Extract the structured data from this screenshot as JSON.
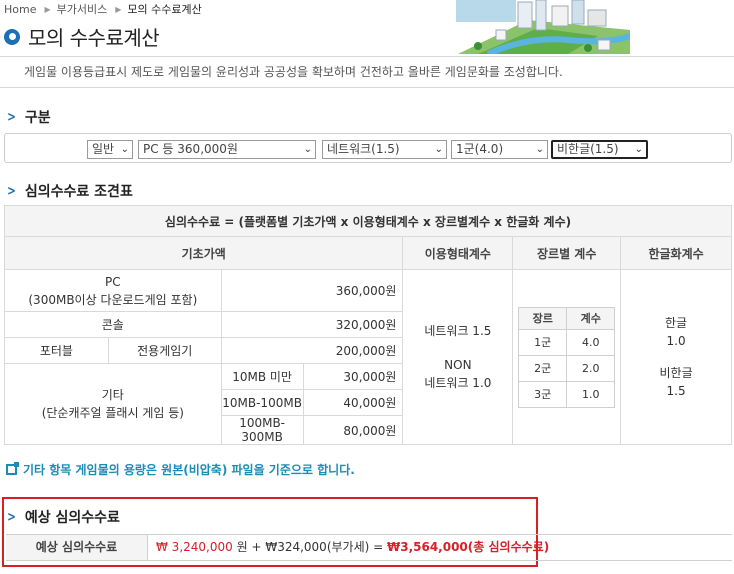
{
  "breadcrumb": {
    "home": "Home",
    "parent": "부가서비스",
    "current": "모의 수수료계산"
  },
  "page_title": "모의 수수료계산",
  "notice": "게임물 이용등급표시 제도로 게임물의 윤리성과 공공성을 확보하며 건전하고 올바른 게임문화를 조성합니다.",
  "sections": {
    "category": "구분",
    "conditions": "심의수수료 조견표",
    "estimate": "예상 심의수수료"
  },
  "selects": {
    "type": "일반",
    "platform": "PC 등 360,000원",
    "usage": "네트워크(1.5)",
    "genre": "1군(4.0)",
    "localization": "비한글(1.5)"
  },
  "table": {
    "formula": "심의수수료 = (플랫폼별 기초가액 x 이용형태계수 x 장르별계수 x 한글화 계수)",
    "headers": {
      "base": "기초가액",
      "usage": "이용형태계수",
      "genre": "장르별 계수",
      "korean": "한글화계수"
    },
    "pc": {
      "label1": "PC",
      "label2": "(300MB이상 다운로드게임 포함)",
      "price": "360,000원"
    },
    "console": {
      "label": "콘솔",
      "price": "320,000원"
    },
    "portable": {
      "label": "포터블",
      "sub": "전용게임기",
      "price": "200,000원"
    },
    "other": {
      "label1": "기타",
      "label2": "(단순캐주얼 플래시 게임 등)",
      "rows": [
        {
          "size": "10MB 미만",
          "price": "30,000원"
        },
        {
          "size": "10MB-100MB",
          "price": "40,000원"
        },
        {
          "size": "100MB-300MB",
          "price": "80,000원"
        }
      ]
    },
    "usage_vals": {
      "network": "네트워크 1.5",
      "non1": "NON",
      "non2": "네트워크 1.0"
    },
    "genre_table": {
      "head_genre": "장르",
      "head_coef": "계수",
      "rows": [
        {
          "genre": "1군",
          "coef": "4.0"
        },
        {
          "genre": "2군",
          "coef": "2.0"
        },
        {
          "genre": "3군",
          "coef": "1.0"
        }
      ]
    },
    "korean_vals": {
      "kor": "한글",
      "kor_val": "1.0",
      "nonkor": "비한글",
      "nonkor_val": "1.5"
    }
  },
  "note": "기타 항목 게임물의 용량은 원본(비압축) 파일을 기준으로 합니다.",
  "estimate": {
    "label": "예상 심의수수료",
    "base": "₩ 3,240,000",
    "won": "원 + ",
    "vat": "₩324,000(부가세) = ",
    "total": "₩3,564,000(총 심의수수료)"
  }
}
